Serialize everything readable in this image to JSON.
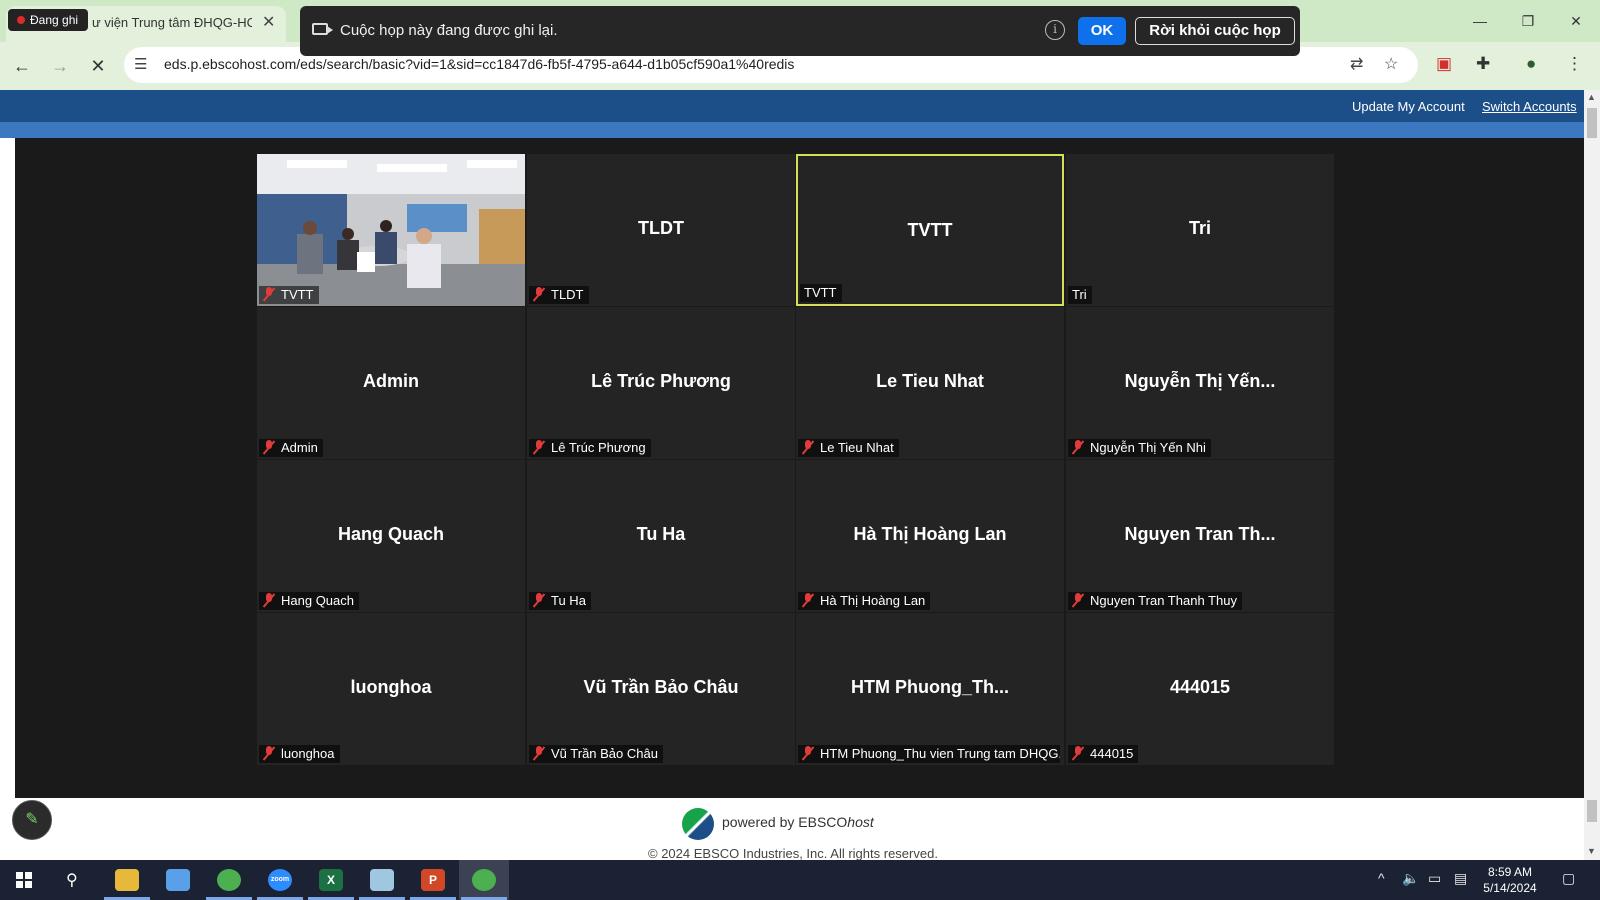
{
  "browser": {
    "tab_title": "ư viện Trung tâm ĐHQG-HCM",
    "recording_pill": "Đang ghi",
    "url": "eds.p.ebscohost.com/eds/search/basic?vid=1&sid=cc1847d6-fb5f-4795-a644-d1b05cf590a1%40redis"
  },
  "zoom_banner": {
    "message": "Cuộc họp này đang được ghi lại.",
    "ok_label": "OK",
    "leave_label": "Rời khỏi cuộc họp"
  },
  "ebsco": {
    "update_account": "Update My Account",
    "switch_accounts": "Switch Accounts",
    "powered_prefix": "powered by EBSCO",
    "powered_suffix": "host",
    "copyright": "© 2024 EBSCO Industries, Inc. All rights reserved."
  },
  "gallery": {
    "tiles": [
      {
        "center": "",
        "label": "TVTT",
        "muted": true,
        "video": true,
        "active": false
      },
      {
        "center": "TLDT",
        "label": "TLDT",
        "muted": true,
        "video": false,
        "active": false
      },
      {
        "center": "TVTT",
        "label": "TVTT",
        "muted": false,
        "video": false,
        "active": true
      },
      {
        "center": "Tri",
        "label": "Tri",
        "muted": false,
        "video": false,
        "active": false
      },
      {
        "center": "Admin",
        "label": "Admin",
        "muted": true,
        "video": false,
        "active": false
      },
      {
        "center": "Lê Trúc Phương",
        "label": "Lê Trúc Phương",
        "muted": true,
        "video": false,
        "active": false
      },
      {
        "center": "Le Tieu Nhat",
        "label": "Le Tieu Nhat",
        "muted": true,
        "video": false,
        "active": false
      },
      {
        "center": "Nguyễn Thị Yến...",
        "label": "Nguyễn Thị Yến Nhi",
        "muted": true,
        "video": false,
        "active": false
      },
      {
        "center": "Hang Quach",
        "label": "Hang Quach",
        "muted": true,
        "video": false,
        "active": false
      },
      {
        "center": "Tu Ha",
        "label": "Tu Ha",
        "muted": true,
        "video": false,
        "active": false
      },
      {
        "center": "Hà Thị Hoàng Lan",
        "label": "Hà Thị Hoàng Lan",
        "muted": true,
        "video": false,
        "active": false
      },
      {
        "center": "Nguyen Tran Th...",
        "label": "Nguyen Tran Thanh Thuy",
        "muted": true,
        "video": false,
        "active": false
      },
      {
        "center": "luonghoa",
        "label": "luonghoa",
        "muted": true,
        "video": false,
        "active": false
      },
      {
        "center": "Vũ Trần Bảo Châu",
        "label": "Vũ Trần Bảo Châu",
        "muted": true,
        "video": false,
        "active": false
      },
      {
        "center": "HTM  Phuong_Th...",
        "label": "HTM Phuong_Thu vien Trung tam DHQG...",
        "muted": true,
        "video": false,
        "active": false
      },
      {
        "center": "444015",
        "label": "444015",
        "muted": true,
        "video": false,
        "active": false
      }
    ]
  },
  "taskbar": {
    "apps": [
      {
        "name": "file-explorer",
        "glyph": "",
        "color": "#e8b83a",
        "running": true,
        "active": false
      },
      {
        "name": "snipping-tool",
        "glyph": "",
        "color": "#5aa0e8",
        "running": false,
        "active": false
      },
      {
        "name": "chrome",
        "glyph": "",
        "color": "#4caf50",
        "running": true,
        "active": false
      },
      {
        "name": "zoom",
        "glyph": "zoom",
        "color": "#2d8cff",
        "running": true,
        "active": false
      },
      {
        "name": "excel",
        "glyph": "X",
        "color": "#1d7044",
        "running": true,
        "active": false
      },
      {
        "name": "notes",
        "glyph": "",
        "color": "#9fc7e0",
        "running": true,
        "active": false
      },
      {
        "name": "powerpoint",
        "glyph": "P",
        "color": "#d24726",
        "running": true,
        "active": false
      },
      {
        "name": "chrome-profile",
        "glyph": "",
        "color": "#4caf50",
        "running": true,
        "active": true
      }
    ],
    "clock_time": "8:59 AM",
    "clock_date": "5/14/2024"
  }
}
